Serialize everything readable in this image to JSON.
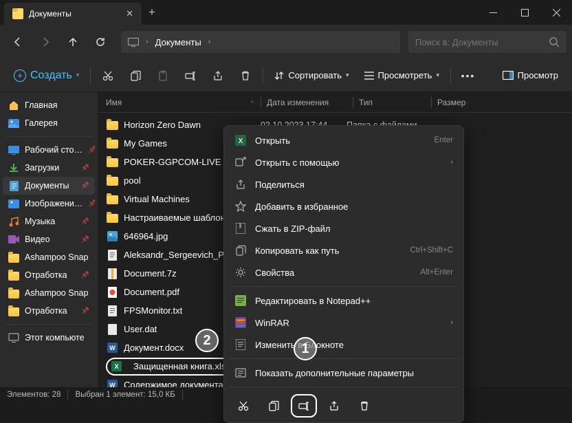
{
  "tab": {
    "title": "Документы"
  },
  "breadcrumb": {
    "current": "Документы"
  },
  "search": {
    "placeholder": "Поиск в: Документы"
  },
  "actions": {
    "create": "Создать",
    "sort": "Сортировать",
    "view": "Просмотреть",
    "preview": "Просмотр"
  },
  "sidebar": {
    "items": [
      {
        "label": "Главная",
        "icon": "home"
      },
      {
        "label": "Галерея",
        "icon": "gallery"
      }
    ],
    "pinned": [
      {
        "label": "Рабочий сто…",
        "icon": "desktop",
        "pin": true
      },
      {
        "label": "Загрузки",
        "icon": "downloads",
        "pin": true
      },
      {
        "label": "Документы",
        "icon": "docs",
        "pin": true,
        "active": true
      },
      {
        "label": "Изображени…",
        "icon": "pictures",
        "pin": true
      },
      {
        "label": "Музыка",
        "icon": "music",
        "pin": true
      },
      {
        "label": "Видео",
        "icon": "video",
        "pin": true
      },
      {
        "label": "Ashampoo Snap",
        "icon": "folder",
        "pin": true
      },
      {
        "label": "Отработка",
        "icon": "folder",
        "pin": true
      },
      {
        "label": "Ashampoo Snap",
        "icon": "folder",
        "pin": true
      },
      {
        "label": "Отработка",
        "icon": "folder",
        "pin": true
      }
    ],
    "footer": [
      {
        "label": "Этот компьюте",
        "icon": "pc"
      }
    ]
  },
  "columns": {
    "name": "Имя",
    "date": "Дата изменения",
    "type": "Тип",
    "size": "Размер"
  },
  "files": [
    {
      "name": "Horizon Zero Dawn",
      "icon": "folder",
      "date": "02.10.2023 17:44",
      "type": "Папка с файлами"
    },
    {
      "name": "My Games",
      "icon": "folder"
    },
    {
      "name": "POKER-GGPCOM-LIVE",
      "icon": "folder"
    },
    {
      "name": "pool",
      "icon": "folder"
    },
    {
      "name": "Virtual Machines",
      "icon": "folder"
    },
    {
      "name": "Настраиваемые шаблоны Off",
      "icon": "folder"
    },
    {
      "name": "646964.jpg",
      "icon": "image"
    },
    {
      "name": "Aleksandr_Sergeevich_Pushkin_",
      "icon": "text"
    },
    {
      "name": "Document.7z",
      "icon": "archive"
    },
    {
      "name": "Document.pdf",
      "icon": "pdf"
    },
    {
      "name": "FPSMonitor.txt",
      "icon": "text"
    },
    {
      "name": "User.dat",
      "icon": "file"
    },
    {
      "name": "Документ.docx",
      "icon": "word"
    },
    {
      "name": "Защищенная книга.xlsx",
      "icon": "excel",
      "selected": true
    },
    {
      "name": "Содержимое документа для р",
      "icon": "word"
    }
  ],
  "context": {
    "items": [
      {
        "label": "Открыть",
        "icon": "excel-app",
        "hint": "Enter"
      },
      {
        "label": "Открыть с помощью",
        "icon": "open-with",
        "sub": true
      },
      {
        "label": "Поделиться",
        "icon": "share"
      },
      {
        "label": "Добавить в избранное",
        "icon": "star"
      },
      {
        "label": "Сжать в ZIP-файл",
        "icon": "zip"
      },
      {
        "label": "Копировать как путь",
        "icon": "copy-path",
        "hint": "Ctrl+Shift+C"
      },
      {
        "label": "Свойства",
        "icon": "props",
        "hint": "Alt+Enter"
      }
    ],
    "items2": [
      {
        "label": "Редактировать в Notepad++",
        "icon": "npp"
      },
      {
        "label": "WinRAR",
        "icon": "winrar",
        "sub": true
      },
      {
        "label": "Изменить в Блокноте",
        "icon": "notepad"
      }
    ],
    "items3": [
      {
        "label": "Показать дополнительные параметры",
        "icon": "more"
      }
    ]
  },
  "status": {
    "count": "Элементов: 28",
    "selected": "Выбран 1 элемент: 15,0 КБ"
  },
  "callouts": {
    "1": "1",
    "2": "2"
  }
}
